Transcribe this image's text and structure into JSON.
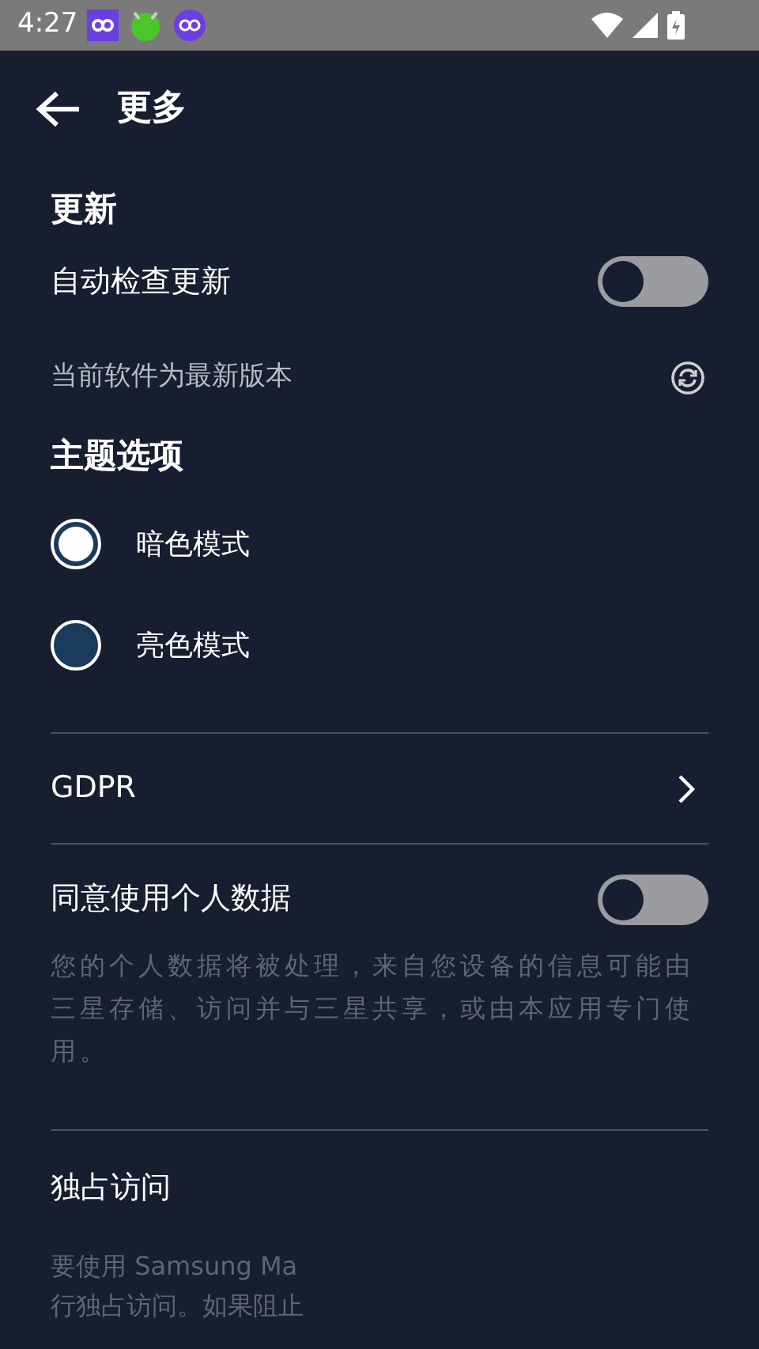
{
  "status_bar": {
    "time": "4:27"
  },
  "header": {
    "title": "更多"
  },
  "update": {
    "heading": "更新",
    "auto_check": {
      "label": "自动检查更新",
      "on": false
    },
    "status": "当前软件为最新版本"
  },
  "theme": {
    "heading": "主题选项",
    "options": [
      {
        "label": "暗色模式",
        "selected": true
      },
      {
        "label": "亮色模式",
        "selected": false
      }
    ]
  },
  "gdpr": {
    "label": "GDPR"
  },
  "consent": {
    "label": "同意使用个人数据",
    "on": false,
    "description": "您的个人数据将被处理，来自您设备的信息可能由三星存储、访问并与三星共享，或由本应用专门使用。"
  },
  "exclusive_access": {
    "label": "独占访问",
    "description_lines": [
      "要使用 Samsung Ma",
      "行独占访问。如果阻止"
    ]
  }
}
